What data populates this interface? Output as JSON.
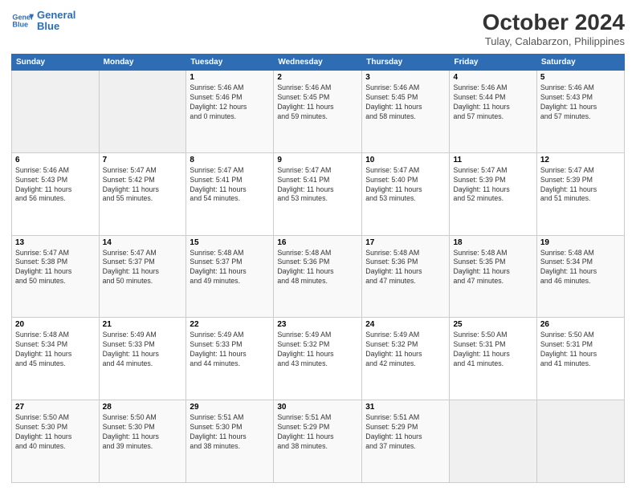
{
  "logo": {
    "line1": "General",
    "line2": "Blue"
  },
  "title": "October 2024",
  "subtitle": "Tulay, Calabarzon, Philippines",
  "headers": [
    "Sunday",
    "Monday",
    "Tuesday",
    "Wednesday",
    "Thursday",
    "Friday",
    "Saturday"
  ],
  "weeks": [
    [
      {
        "day": "",
        "info": ""
      },
      {
        "day": "",
        "info": ""
      },
      {
        "day": "1",
        "info": "Sunrise: 5:46 AM\nSunset: 5:46 PM\nDaylight: 12 hours\nand 0 minutes."
      },
      {
        "day": "2",
        "info": "Sunrise: 5:46 AM\nSunset: 5:45 PM\nDaylight: 11 hours\nand 59 minutes."
      },
      {
        "day": "3",
        "info": "Sunrise: 5:46 AM\nSunset: 5:45 PM\nDaylight: 11 hours\nand 58 minutes."
      },
      {
        "day": "4",
        "info": "Sunrise: 5:46 AM\nSunset: 5:44 PM\nDaylight: 11 hours\nand 57 minutes."
      },
      {
        "day": "5",
        "info": "Sunrise: 5:46 AM\nSunset: 5:43 PM\nDaylight: 11 hours\nand 57 minutes."
      }
    ],
    [
      {
        "day": "6",
        "info": "Sunrise: 5:46 AM\nSunset: 5:43 PM\nDaylight: 11 hours\nand 56 minutes."
      },
      {
        "day": "7",
        "info": "Sunrise: 5:47 AM\nSunset: 5:42 PM\nDaylight: 11 hours\nand 55 minutes."
      },
      {
        "day": "8",
        "info": "Sunrise: 5:47 AM\nSunset: 5:41 PM\nDaylight: 11 hours\nand 54 minutes."
      },
      {
        "day": "9",
        "info": "Sunrise: 5:47 AM\nSunset: 5:41 PM\nDaylight: 11 hours\nand 53 minutes."
      },
      {
        "day": "10",
        "info": "Sunrise: 5:47 AM\nSunset: 5:40 PM\nDaylight: 11 hours\nand 53 minutes."
      },
      {
        "day": "11",
        "info": "Sunrise: 5:47 AM\nSunset: 5:39 PM\nDaylight: 11 hours\nand 52 minutes."
      },
      {
        "day": "12",
        "info": "Sunrise: 5:47 AM\nSunset: 5:39 PM\nDaylight: 11 hours\nand 51 minutes."
      }
    ],
    [
      {
        "day": "13",
        "info": "Sunrise: 5:47 AM\nSunset: 5:38 PM\nDaylight: 11 hours\nand 50 minutes."
      },
      {
        "day": "14",
        "info": "Sunrise: 5:47 AM\nSunset: 5:37 PM\nDaylight: 11 hours\nand 50 minutes."
      },
      {
        "day": "15",
        "info": "Sunrise: 5:48 AM\nSunset: 5:37 PM\nDaylight: 11 hours\nand 49 minutes."
      },
      {
        "day": "16",
        "info": "Sunrise: 5:48 AM\nSunset: 5:36 PM\nDaylight: 11 hours\nand 48 minutes."
      },
      {
        "day": "17",
        "info": "Sunrise: 5:48 AM\nSunset: 5:36 PM\nDaylight: 11 hours\nand 47 minutes."
      },
      {
        "day": "18",
        "info": "Sunrise: 5:48 AM\nSunset: 5:35 PM\nDaylight: 11 hours\nand 47 minutes."
      },
      {
        "day": "19",
        "info": "Sunrise: 5:48 AM\nSunset: 5:34 PM\nDaylight: 11 hours\nand 46 minutes."
      }
    ],
    [
      {
        "day": "20",
        "info": "Sunrise: 5:48 AM\nSunset: 5:34 PM\nDaylight: 11 hours\nand 45 minutes."
      },
      {
        "day": "21",
        "info": "Sunrise: 5:49 AM\nSunset: 5:33 PM\nDaylight: 11 hours\nand 44 minutes."
      },
      {
        "day": "22",
        "info": "Sunrise: 5:49 AM\nSunset: 5:33 PM\nDaylight: 11 hours\nand 44 minutes."
      },
      {
        "day": "23",
        "info": "Sunrise: 5:49 AM\nSunset: 5:32 PM\nDaylight: 11 hours\nand 43 minutes."
      },
      {
        "day": "24",
        "info": "Sunrise: 5:49 AM\nSunset: 5:32 PM\nDaylight: 11 hours\nand 42 minutes."
      },
      {
        "day": "25",
        "info": "Sunrise: 5:50 AM\nSunset: 5:31 PM\nDaylight: 11 hours\nand 41 minutes."
      },
      {
        "day": "26",
        "info": "Sunrise: 5:50 AM\nSunset: 5:31 PM\nDaylight: 11 hours\nand 41 minutes."
      }
    ],
    [
      {
        "day": "27",
        "info": "Sunrise: 5:50 AM\nSunset: 5:30 PM\nDaylight: 11 hours\nand 40 minutes."
      },
      {
        "day": "28",
        "info": "Sunrise: 5:50 AM\nSunset: 5:30 PM\nDaylight: 11 hours\nand 39 minutes."
      },
      {
        "day": "29",
        "info": "Sunrise: 5:51 AM\nSunset: 5:30 PM\nDaylight: 11 hours\nand 38 minutes."
      },
      {
        "day": "30",
        "info": "Sunrise: 5:51 AM\nSunset: 5:29 PM\nDaylight: 11 hours\nand 38 minutes."
      },
      {
        "day": "31",
        "info": "Sunrise: 5:51 AM\nSunset: 5:29 PM\nDaylight: 11 hours\nand 37 minutes."
      },
      {
        "day": "",
        "info": ""
      },
      {
        "day": "",
        "info": ""
      }
    ]
  ]
}
